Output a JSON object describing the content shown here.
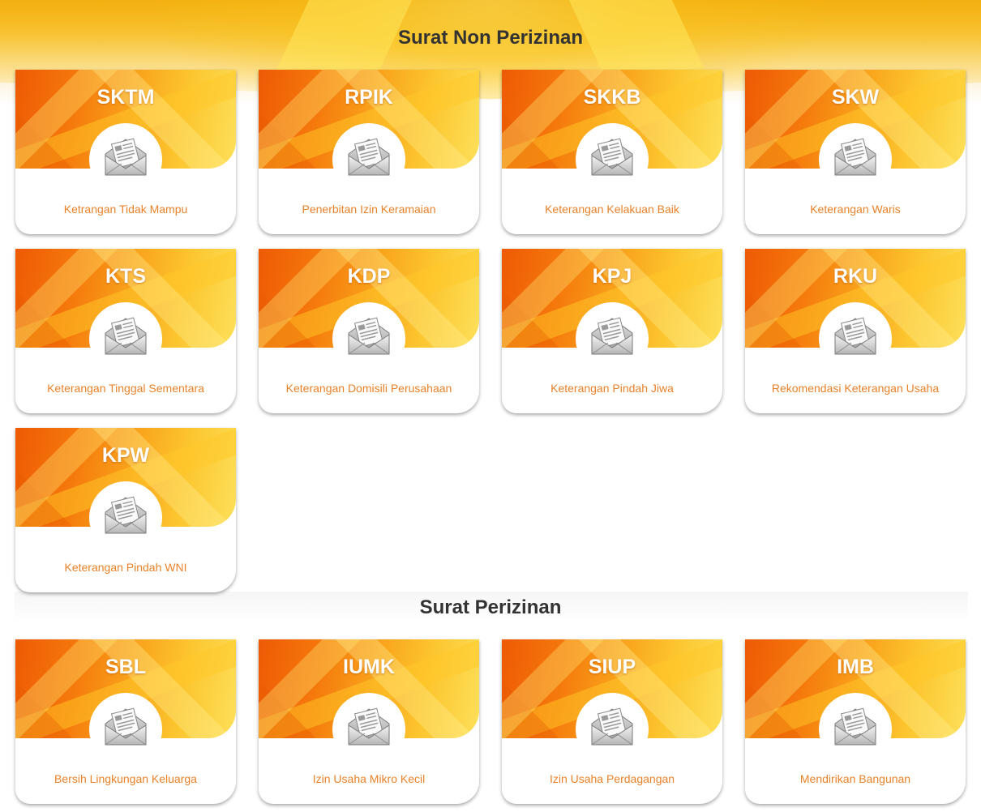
{
  "sections": [
    {
      "title": "Surat Non Perizinan",
      "cards": [
        {
          "code": "SKTM",
          "label": "Ketrangan Tidak Mampu"
        },
        {
          "code": "RPIK",
          "label": "Penerbitan Izin Keramaian"
        },
        {
          "code": "SKKB",
          "label": "Keterangan Kelakuan Baik"
        },
        {
          "code": "SKW",
          "label": "Keterangan Waris"
        },
        {
          "code": "KTS",
          "label": "Keterangan Tinggal Sementara"
        },
        {
          "code": "KDP",
          "label": "Keterangan Domisili Perusahaan"
        },
        {
          "code": "KPJ",
          "label": "Keterangan Pindah Jiwa"
        },
        {
          "code": "RKU",
          "label": "Rekomendasi Keterangan Usaha"
        },
        {
          "code": "KPW",
          "label": "Keterangan Pindah WNI"
        }
      ]
    },
    {
      "title": "Surat Perizinan",
      "cards": [
        {
          "code": "SBL",
          "label": "Bersih Lingkungan Keluarga"
        },
        {
          "code": "IUMK",
          "label": "Izin Usaha Mikro Kecil"
        },
        {
          "code": "SIUP",
          "label": "Izin Usaha Perdagangan"
        },
        {
          "code": "IMB",
          "label": "Mendirikan Bangunan"
        }
      ]
    }
  ],
  "icons": {
    "card_icon": "envelope-document-icon"
  },
  "colors": {
    "label_text": "#e9822a",
    "title_text": "#333333",
    "card_code_text": "#ffffff",
    "accent_orange": "#f57a0c",
    "accent_yellow": "#fde05a"
  }
}
